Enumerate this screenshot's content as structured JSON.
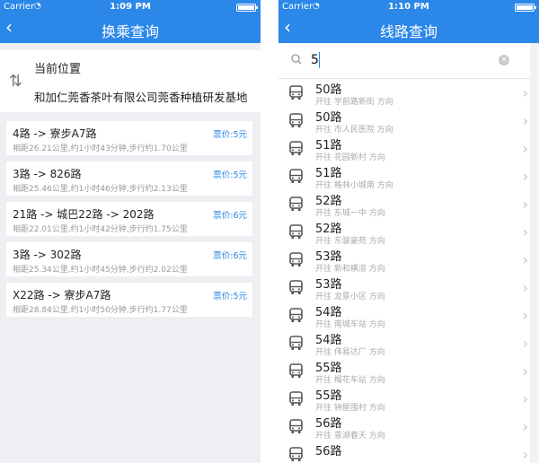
{
  "left": {
    "status": {
      "carrier": "Carrier",
      "time": "1:09 PM"
    },
    "nav": {
      "back": "‹",
      "title": "换乘查询"
    },
    "location": {
      "from": "当前位置",
      "to": "和加仁莞香茶叶有限公司莞香种植研发基地"
    },
    "routes": [
      {
        "title": "4路 -> 寮步A7路",
        "meta": "相距26.21公里,约1小时43分钟,步行约1.70公里",
        "fare": "票价:5元"
      },
      {
        "title": "3路 -> 826路",
        "meta": "相距25.46公里,约1小时46分钟,步行约2.13公里",
        "fare": "票价:5元"
      },
      {
        "title": "21路 -> 城巴22路 -> 202路",
        "meta": "相距22.01公里,约1小时42分钟,步行约1.75公里",
        "fare": "票价:6元"
      },
      {
        "title": "3路 -> 302路",
        "meta": "相距25.34公里,约1小时45分钟,步行约2.02公里",
        "fare": "票价:6元"
      },
      {
        "title": "X22路 -> 寮步A7路",
        "meta": "相距28.84公里,约1小时50分钟,步行约1.77公里",
        "fare": "票价:5元"
      }
    ]
  },
  "right": {
    "status": {
      "carrier": "Carrier",
      "time": "1:10 PM"
    },
    "nav": {
      "back": "‹",
      "title": "线路查询"
    },
    "search": {
      "value": "5"
    },
    "lines": [
      {
        "name": "50路",
        "dir": "开往 学前路新街 方向"
      },
      {
        "name": "50路",
        "dir": "开往 市人民医院 方向"
      },
      {
        "name": "51路",
        "dir": "开往 花园新村 方向"
      },
      {
        "name": "51路",
        "dir": "开往 格林小城南 方向"
      },
      {
        "name": "52路",
        "dir": "开往 东城一中 方向"
      },
      {
        "name": "52路",
        "dir": "开往 东骏豪苑 方向"
      },
      {
        "name": "53路",
        "dir": "开往 新和横溶 方向"
      },
      {
        "name": "53路",
        "dir": "开往 龙景小区 方向"
      },
      {
        "name": "54路",
        "dir": "开往 南城车站 方向"
      },
      {
        "name": "54路",
        "dir": "开往 伟易达厂 方向"
      },
      {
        "name": "55路",
        "dir": "开往 榴花车站 方向"
      },
      {
        "name": "55路",
        "dir": "开往 钟屋围村 方向"
      },
      {
        "name": "56路",
        "dir": "开往 景湖春天 方向"
      },
      {
        "name": "56路",
        "dir": ""
      }
    ]
  },
  "colors": {
    "accent": "#2b87e8",
    "background": "#eeeff3"
  }
}
